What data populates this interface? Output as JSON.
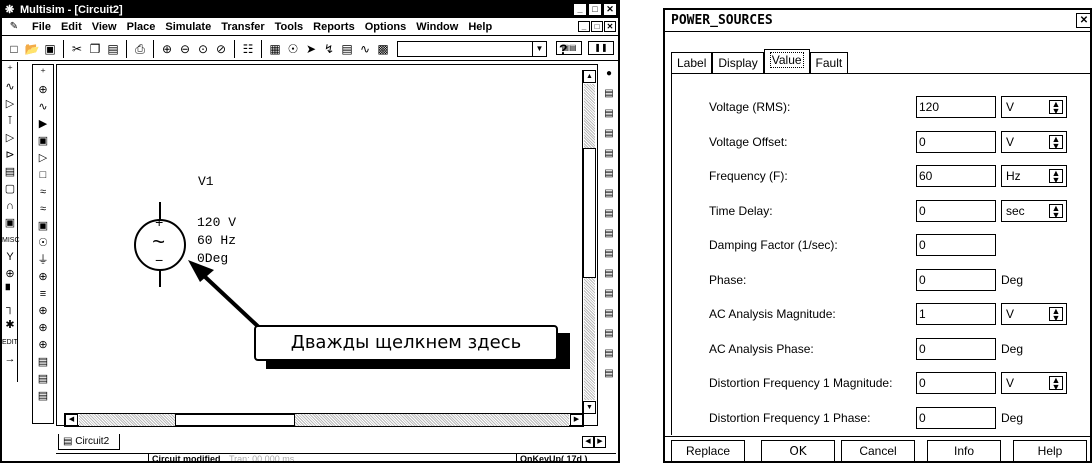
{
  "left_window": {
    "title": "Multisim - [Circuit2]",
    "menu": [
      "File",
      "Edit",
      "View",
      "Place",
      "Simulate",
      "Transfer",
      "Tools",
      "Reports",
      "Options",
      "Window",
      "Help"
    ],
    "help_glyph": "?",
    "schematic": {
      "ref": "V1",
      "voltage": "120 V",
      "frequency": "60 Hz",
      "phase": "0Deg",
      "plus": "+",
      "minus": "−",
      "wave": "~"
    },
    "callout_text": "Дважды щелкнем здесь",
    "doc_tab": "Circuit2",
    "status": {
      "modified": "Circuit modified",
      "tran": "Tran: 00.000 ms",
      "event": "OnKeyUp( 17d )"
    }
  },
  "dialog": {
    "title": "POWER_SOURCES",
    "tabs": [
      "Label",
      "Display",
      "Value",
      "Fault"
    ],
    "active_tab": "Value",
    "rows": [
      {
        "label": "Voltage (RMS):",
        "value": "120",
        "unit": "V",
        "spin": true
      },
      {
        "label": "Voltage Offset:",
        "value": "0",
        "unit": "V",
        "spin": true
      },
      {
        "label": "Frequency (F):",
        "value": "60",
        "unit": "Hz",
        "spin": true
      },
      {
        "label": "Time Delay:",
        "value": "0",
        "unit": "sec",
        "spin": true
      },
      {
        "label": "Damping Factor (1/sec):",
        "value": "0",
        "unit": "",
        "spin": false
      },
      {
        "label": "Phase:",
        "value": "0",
        "unit": "Deg",
        "spin": false
      },
      {
        "label": "AC Analysis Magnitude:",
        "value": "1",
        "unit": "V",
        "spin": true
      },
      {
        "label": "AC Analysis Phase:",
        "value": "0",
        "unit": "Deg",
        "spin": false
      },
      {
        "label": "Distortion Frequency 1 Magnitude:",
        "value": "0",
        "unit": "V",
        "spin": true
      },
      {
        "label": "Distortion Frequency 1 Phase:",
        "value": "0",
        "unit": "Deg",
        "spin": false
      }
    ],
    "buttons": {
      "replace": "Replace",
      "ok": "OK",
      "cancel": "Cancel",
      "info": "Info",
      "help": "Help"
    }
  }
}
